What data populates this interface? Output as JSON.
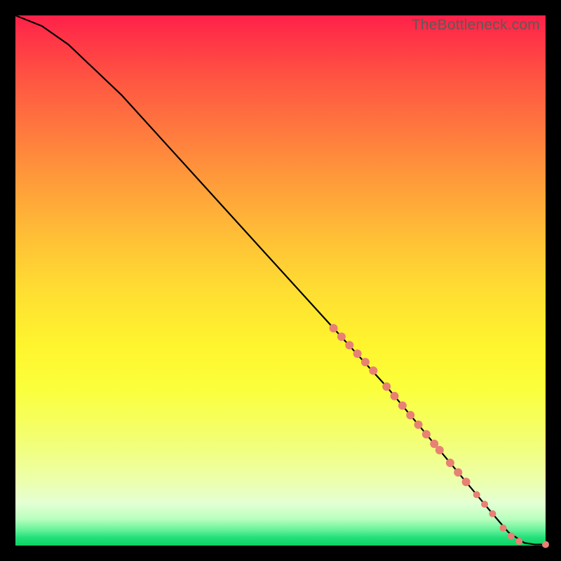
{
  "watermark": "TheBottleneck.com",
  "chart_data": {
    "type": "line",
    "title": "",
    "xlabel": "",
    "ylabel": "",
    "xlim": [
      0,
      100
    ],
    "ylim": [
      0,
      100
    ],
    "grid": false,
    "series": [
      {
        "name": "curve",
        "x": [
          0,
          5,
          10,
          20,
          30,
          40,
          50,
          60,
          70,
          80,
          85,
          90,
          93,
          96,
          98,
          100
        ],
        "y": [
          100,
          98,
          94.5,
          85,
          74,
          63,
          52,
          41,
          30,
          18,
          12,
          6,
          2.5,
          0.5,
          0.2,
          0.2
        ]
      }
    ],
    "markers": {
      "name": "highlighted-points",
      "color": "#e88074",
      "points": [
        {
          "x": 60,
          "y": 41,
          "r": 6
        },
        {
          "x": 61.5,
          "y": 39.4,
          "r": 6
        },
        {
          "x": 63,
          "y": 37.8,
          "r": 6
        },
        {
          "x": 64.5,
          "y": 36.2,
          "r": 6
        },
        {
          "x": 66,
          "y": 34.6,
          "r": 6
        },
        {
          "x": 67.5,
          "y": 33,
          "r": 6
        },
        {
          "x": 70,
          "y": 30,
          "r": 6
        },
        {
          "x": 71.5,
          "y": 28.2,
          "r": 6
        },
        {
          "x": 73,
          "y": 26.4,
          "r": 6
        },
        {
          "x": 74.5,
          "y": 24.6,
          "r": 6
        },
        {
          "x": 76,
          "y": 22.8,
          "r": 6
        },
        {
          "x": 77.5,
          "y": 21,
          "r": 6
        },
        {
          "x": 79,
          "y": 19.2,
          "r": 6
        },
        {
          "x": 80,
          "y": 18,
          "r": 6
        },
        {
          "x": 82,
          "y": 15.6,
          "r": 6
        },
        {
          "x": 83.5,
          "y": 13.8,
          "r": 6
        },
        {
          "x": 85,
          "y": 12,
          "r": 6
        },
        {
          "x": 87,
          "y": 9.6,
          "r": 5
        },
        {
          "x": 88.5,
          "y": 7.8,
          "r": 5
        },
        {
          "x": 90,
          "y": 6,
          "r": 5
        },
        {
          "x": 92,
          "y": 3.3,
          "r": 5
        },
        {
          "x": 93.5,
          "y": 1.8,
          "r": 5
        },
        {
          "x": 95,
          "y": 0.8,
          "r": 5
        },
        {
          "x": 100,
          "y": 0.2,
          "r": 5
        }
      ]
    }
  }
}
